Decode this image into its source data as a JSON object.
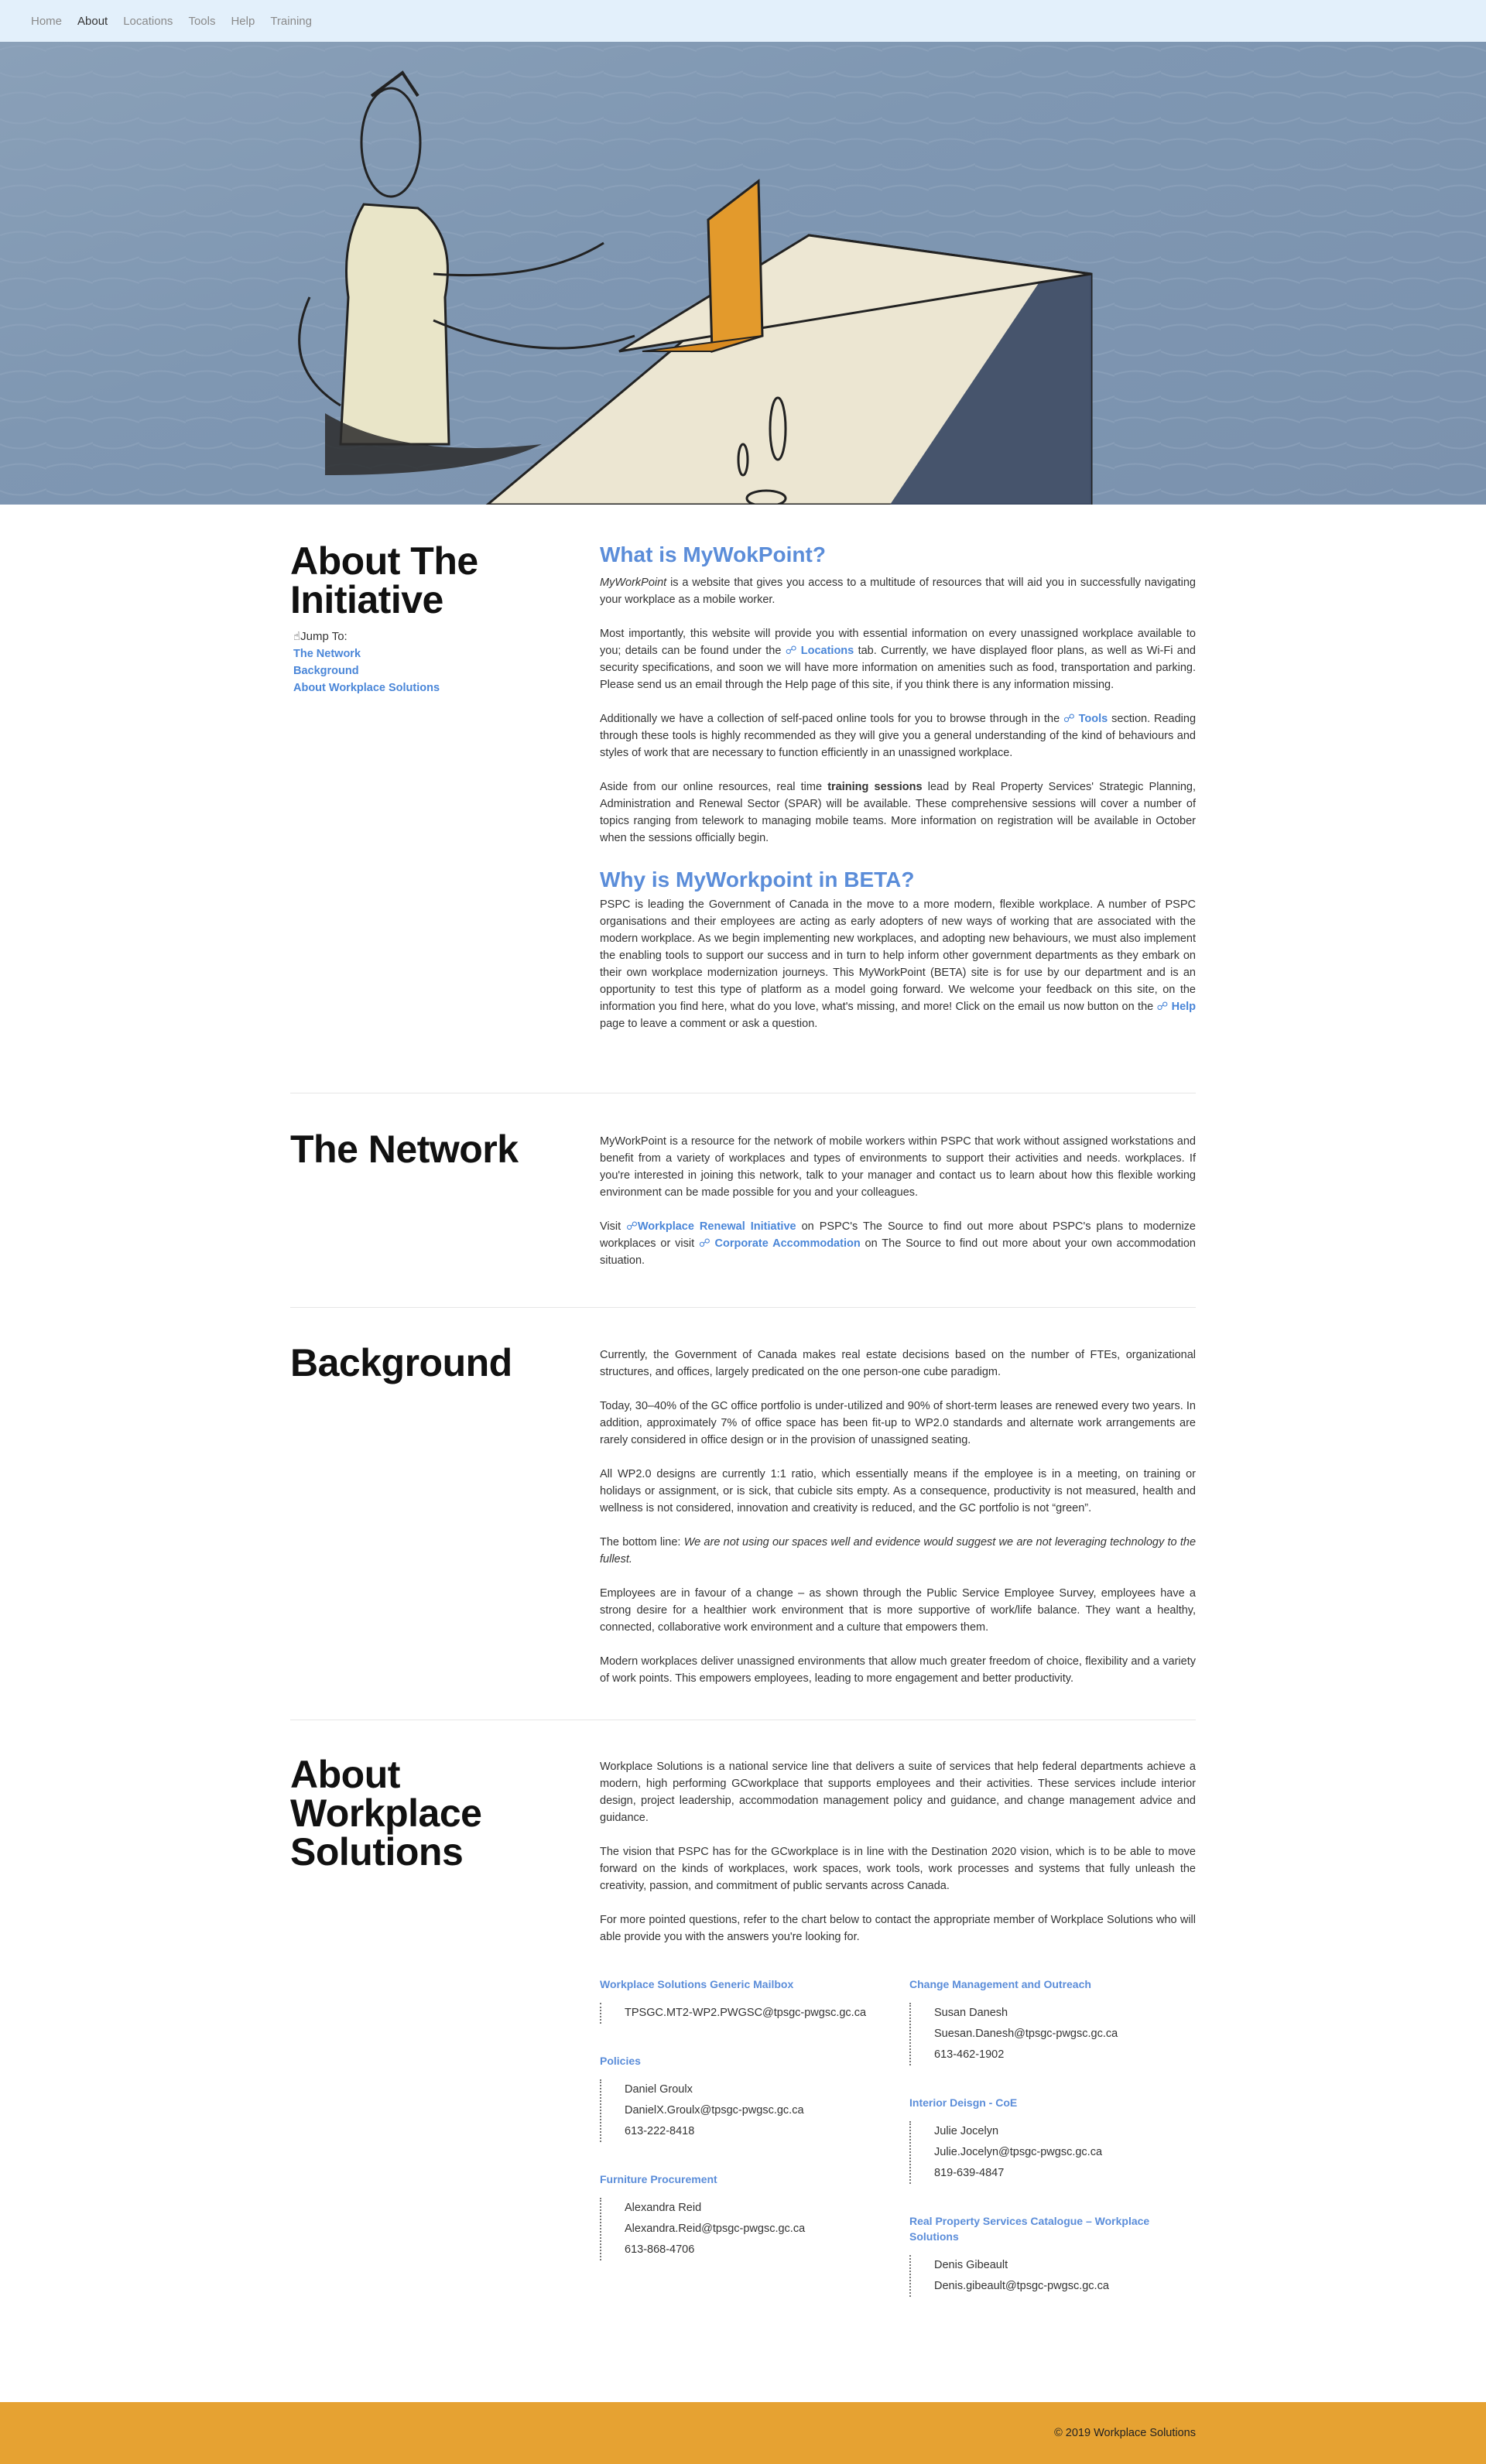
{
  "nav": {
    "items": [
      "Home",
      "About",
      "Locations",
      "Tools",
      "Help",
      "Training"
    ],
    "active": "About"
  },
  "colors": {
    "accent": "#5b8dd9",
    "link": "#4a86d8",
    "footer": "#e6a232",
    "nav_bg": "#e3f0fb"
  },
  "intro": {
    "title": "About The Initiative",
    "jump_label": "Jump To:",
    "jump_links": [
      "The Network",
      "Background",
      "About Workplace Solutions"
    ],
    "q1": "What is MyWokPoint?",
    "p1_em": "MyWorkPoint",
    "p1_rest": " is a website that gives you access to a multitude of resources that will aid you in successfully navigating your workplace as a mobile worker.",
    "p2_a": "Most importantly, this website will provide you with essential information on every unassigned workplace available to you; details can be found under the ",
    "p2_link": "Locations",
    "p2_b": " tab. Currently, we have displayed floor plans, as well as Wi-Fi and security specifications, and soon we will have more information on amenities such as food, transportation and parking. Please send us an email through the Help page of this site, if you think there is any information missing.",
    "p3_a": "Additionally we have a collection of self-paced online tools for you to browse through in the ",
    "p3_link": "Tools",
    "p3_b": " section. Reading through these tools is highly recommended as they will give you a general understanding of the kind of behaviours and styles of work that are necessary to function efficiently in an unassigned workplace.",
    "p4_a": "Aside from our online resources, real time ",
    "p4_bold": "training sessions",
    "p4_b": " lead by Real Property Services' Strategic Planning, Administration and Renewal Sector (SPAR) will be available. These comprehensive sessions will cover a number of topics ranging from telework to managing mobile teams. More information on registration will be available in October when the sessions officially begin.",
    "q2": "Why is MyWorkpoint in BETA?",
    "p5_a": "PSPC is leading the Government of Canada in the move to a more modern, flexible workplace. A number of PSPC organisations and their employees are acting as early adopters of new ways of working that are associated with the modern workplace. As we begin implementing new workplaces, and adopting new behaviours, we must also implement the enabling tools to support our success and in turn to help inform other government departments as they embark on their own workplace modernization journeys. This MyWorkPoint (BETA) site is for use by our department and is an opportunity to test this type of platform as a model going forward. We welcome your feedback on this site, on the information you find here, what do you love, what's missing, and more! Click on the email us now button on the ",
    "p5_link": "Help",
    "p5_b": " page to leave a comment or ask a question."
  },
  "network": {
    "title": "The Network",
    "p1": "MyWorkPoint is a resource for the network of mobile workers within PSPC that work without assigned workstations and benefit from a variety of workplaces and types of environments to support their activities and needs. workplaces. If you're interested in joining this network, talk to your manager and contact us to learn about how this flexible working environment can be made possible for you and your colleagues.",
    "p2_a": "Visit ",
    "p2_link1": "Workplace Renewal Initiative",
    "p2_b": " on PSPC's The Source to find out more about PSPC's plans to modernize workplaces or visit ",
    "p2_link2": "Corporate Accommodation",
    "p2_c": " on The Source to find out more about your own accommodation situation."
  },
  "background": {
    "title": "Background",
    "p1": "Currently, the Government of Canada makes real estate decisions based on the number of FTEs, organizational structures, and offices, largely predicated on the one person-one cube paradigm.",
    "p2": "Today, 30–40% of the GC office portfolio is under-utilized and 90% of short-term leases are renewed every two years. In addition, approximately 7% of office space has been fit-up to WP2.0 standards and alternate work arrangements are rarely considered in office design or in the provision of unassigned seating.",
    "p3": "All WP2.0 designs are currently 1:1 ratio, which essentially means if the employee is in a meeting, on training or holidays or assignment, or is sick, that cubicle sits empty. As a consequence, productivity is not measured, health and wellness is not considered, innovation and creativity is reduced, and the GC portfolio is not “green”.",
    "p4_a": "The bottom line: ",
    "p4_em": "We are not using our spaces well and evidence would suggest we are not leveraging technology to the fullest.",
    "p5": "Employees are in favour of a change – as shown through the Public Service Employee Survey, employees have a strong desire for a healthier work environment that is more supportive of work/life balance. They want a healthy, connected, collaborative work environment and a culture that empowers them.",
    "p6": "Modern workplaces deliver unassigned environments that allow much greater freedom of choice, flexibility and a variety of work points. This empowers employees, leading to more engagement and better productivity."
  },
  "about_ws": {
    "title": "About Workplace Solutions",
    "p1": "Workplace Solutions is a national service line that delivers a suite of services that help federal departments achieve a modern, high performing GCworkplace that supports employees and their activities. These services include interior design, project leadership, accommodation management policy and guidance, and change management advice and guidance.",
    "p2": "The vision that PSPC has for the GCworkplace is in line with the Destination 2020 vision, which is to be able to move forward on the kinds of workplaces, work spaces, work tools, work processes and systems that fully unleash the creativity, passion, and commitment of public servants across Canada.",
    "p3": "For more pointed questions, refer to the chart below to contact the appropriate member of Workplace Solutions who will able provide you with the answers you're looking for.",
    "contacts_left": [
      {
        "heading": "Workplace Solutions Generic Mailbox",
        "lines": [
          "TPSGC.MT2-WP2.PWGSC@tpsgc-pwgsc.gc.ca"
        ]
      },
      {
        "heading": "Policies",
        "lines": [
          "Daniel Groulx",
          "DanielX.Groulx@tpsgc-pwgsc.gc.ca",
          "613-222-8418"
        ]
      },
      {
        "heading": "Furniture Procurement",
        "lines": [
          "Alexandra Reid",
          "Alexandra.Reid@tpsgc-pwgsc.gc.ca",
          "613-868-4706"
        ]
      }
    ],
    "contacts_right": [
      {
        "heading": "Change Management and Outreach",
        "lines": [
          "Susan Danesh",
          "Suesan.Danesh@tpsgc-pwgsc.gc.ca",
          "613-462-1902"
        ]
      },
      {
        "heading": "Interior Deisgn - CoE",
        "lines": [
          "Julie Jocelyn",
          "Julie.Jocelyn@tpsgc-pwgsc.gc.ca",
          "819-639-4847"
        ]
      },
      {
        "heading": "Real Property Services Catalogue – Workplace Solutions",
        "lines": [
          "Denis Gibeault",
          "Denis.gibeault@tpsgc-pwgsc.gc.ca"
        ]
      }
    ]
  },
  "footer": {
    "text": "© 2019 Workplace Solutions"
  }
}
